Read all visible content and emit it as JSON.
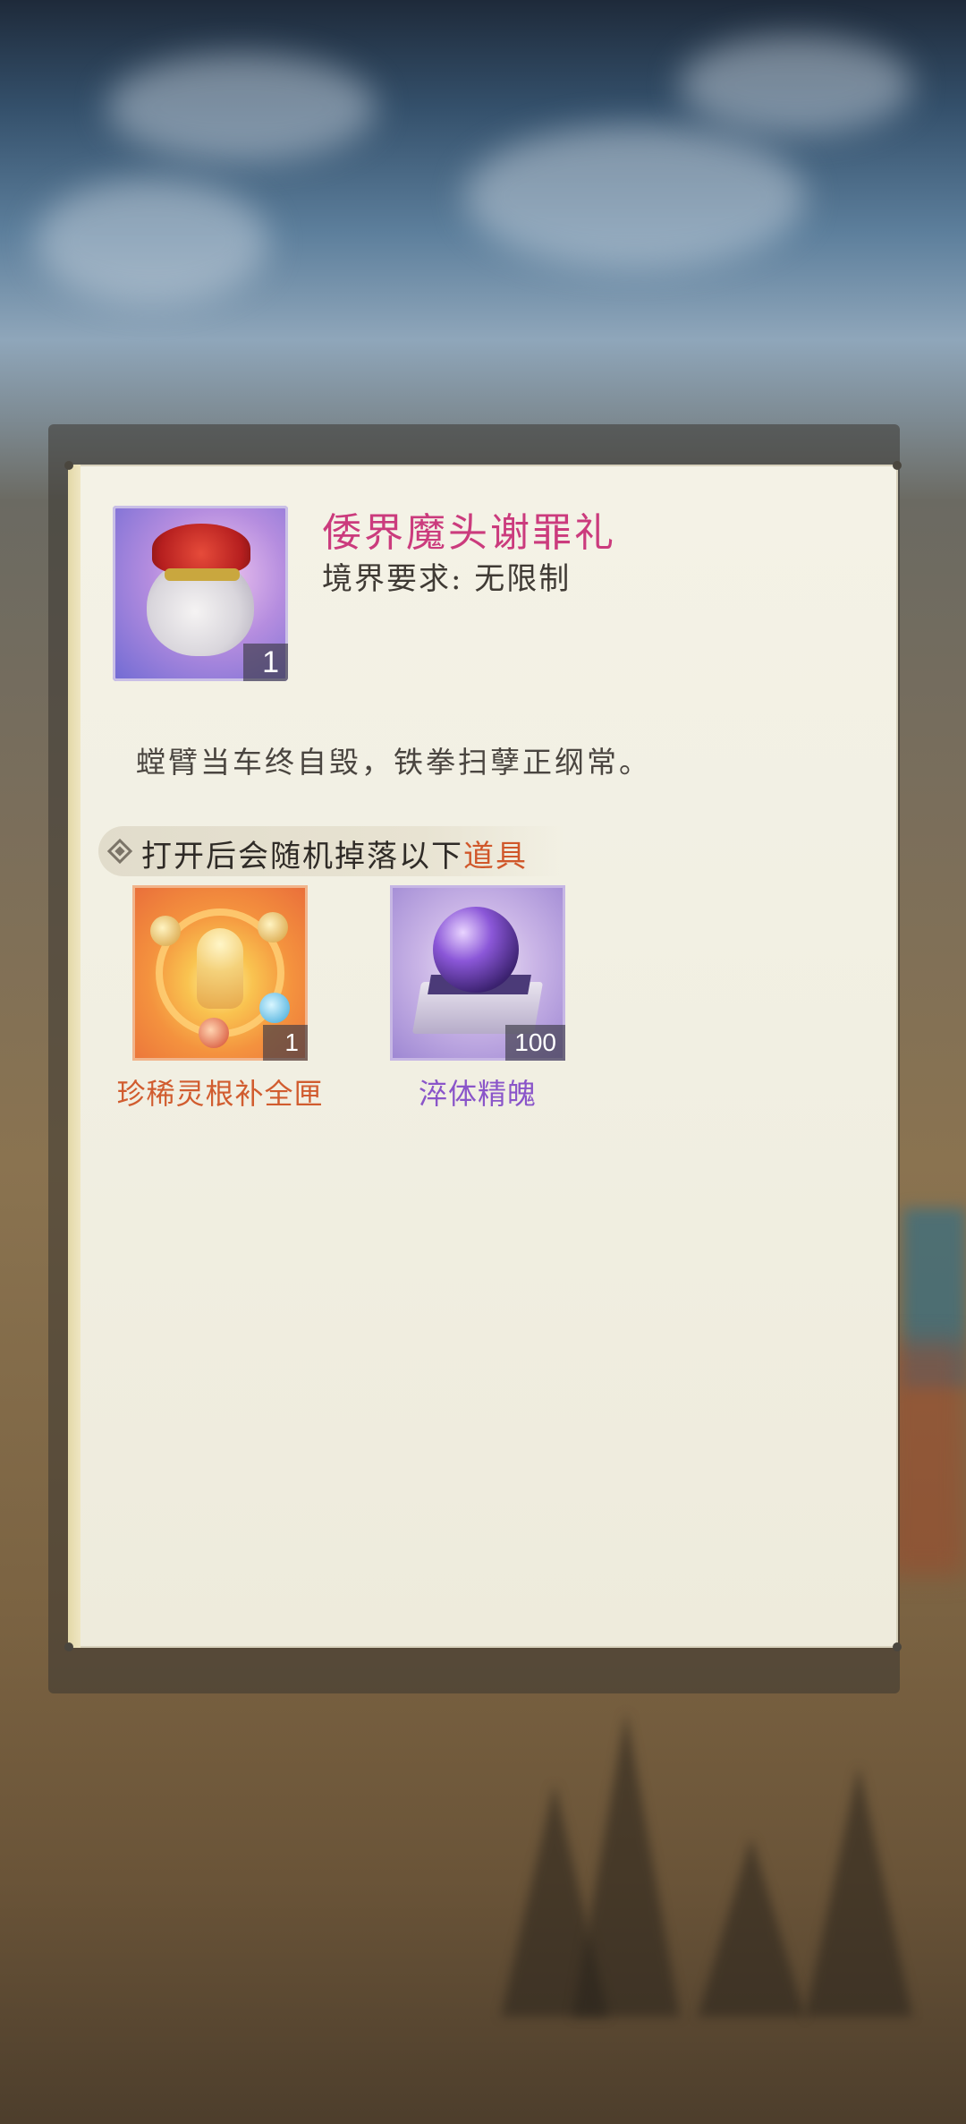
{
  "item": {
    "title": "倭界魔头谢罪礼",
    "requirement_label": "境界要求:",
    "requirement_value": "无限制",
    "count": "1",
    "icon": "red-gift-bag-icon",
    "description": "螳臂当车终自毁，铁拳扫孽正纲常。"
  },
  "drops": {
    "header_prefix": "打开后会随机掉落以下",
    "header_highlight": "道具",
    "items": [
      {
        "name": "珍稀灵根补全匣",
        "count": "1",
        "icon": "meditating-figure-icon",
        "name_color": "#d15c2f"
      },
      {
        "name": "淬体精魄",
        "count": "100",
        "icon": "purple-orb-pedestal-icon",
        "name_color": "#8a55c9"
      }
    ]
  },
  "colors": {
    "title": "#cb3b7d",
    "highlight": "#d0572a"
  }
}
